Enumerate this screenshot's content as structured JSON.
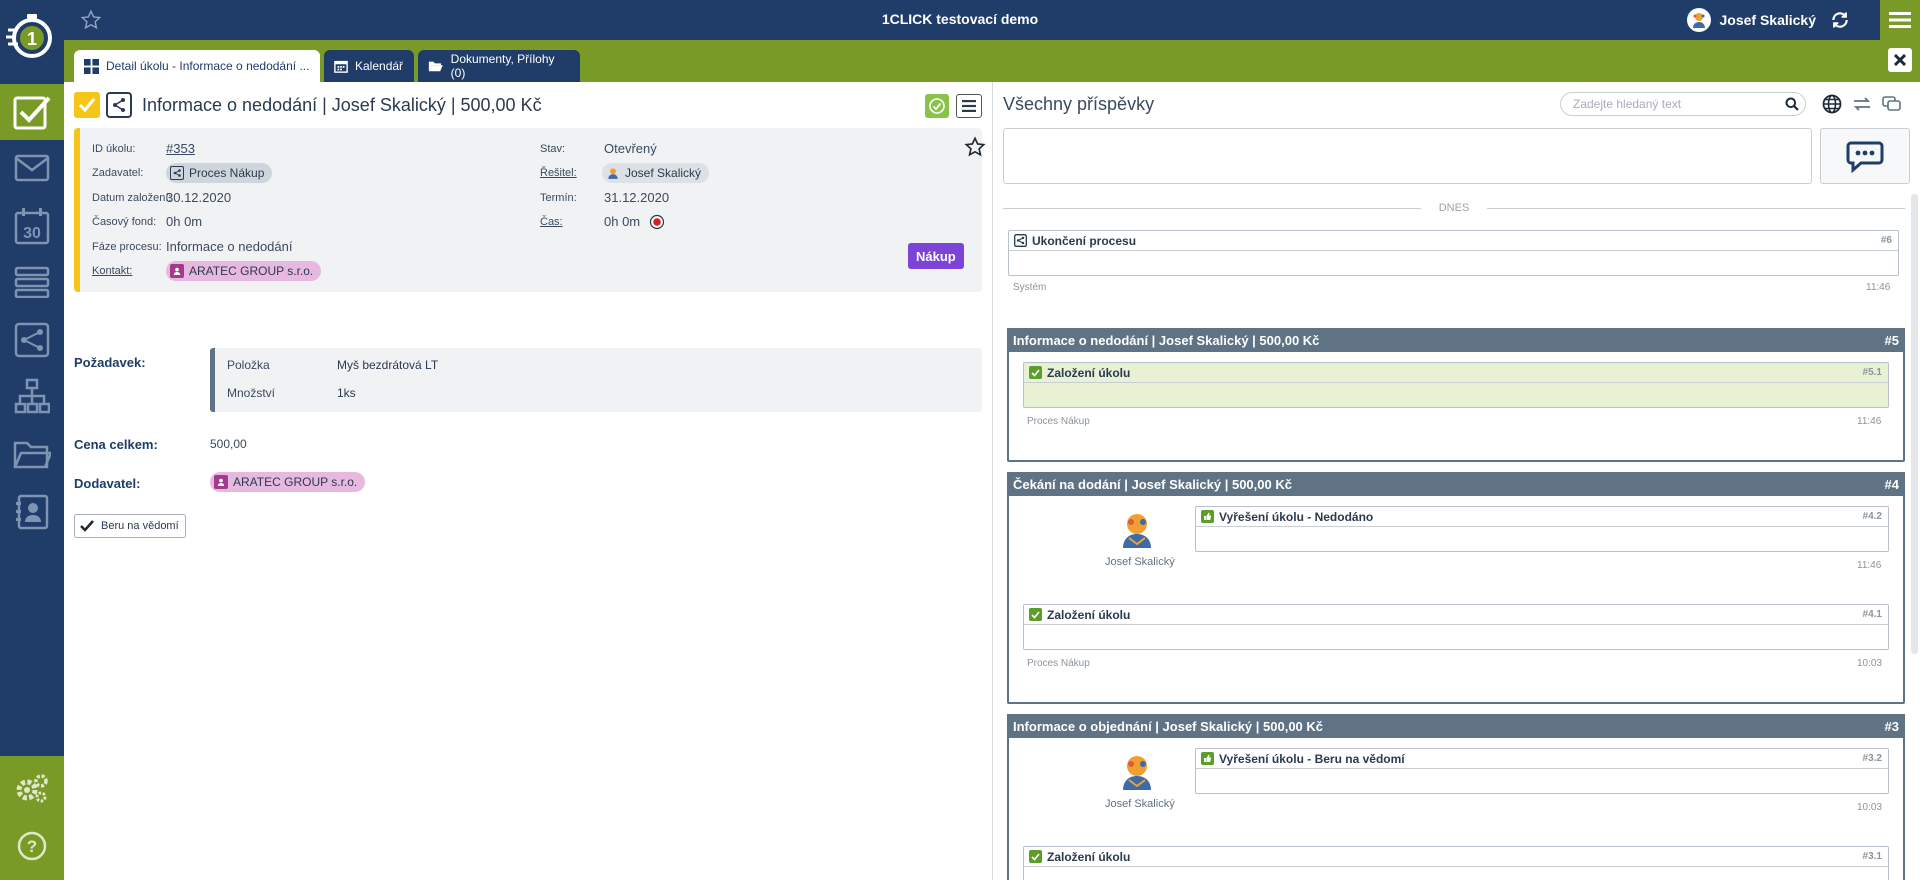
{
  "app": {
    "title": "1CLICK testovací demo",
    "user_name": "Josef Skalický"
  },
  "tabs": [
    {
      "label": "Detail úkolu - Informace o nedodání ...",
      "icon": "dashboard-icon",
      "active": true
    },
    {
      "label": "Kalendář",
      "icon": "calendar-icon",
      "active": false
    },
    {
      "label": "Dokumenty, Přílohy (0)",
      "icon": "folder-open-icon",
      "active": false
    }
  ],
  "sidebar": {
    "items": [
      {
        "name": "tasks",
        "icon": "checkbox-icon",
        "active": true
      },
      {
        "name": "mail",
        "icon": "envelope-icon"
      },
      {
        "name": "calendar",
        "icon": "calendar-30-icon",
        "label": "30"
      },
      {
        "name": "lists",
        "icon": "list-icon"
      },
      {
        "name": "processes",
        "icon": "process-icon"
      },
      {
        "name": "org",
        "icon": "org-chart-icon"
      },
      {
        "name": "documents",
        "icon": "folder-icon"
      },
      {
        "name": "contacts",
        "icon": "contact-card-icon"
      }
    ],
    "bottom": [
      {
        "name": "settings",
        "icon": "gears-icon"
      },
      {
        "name": "help",
        "icon": "help-icon",
        "label": "?"
      }
    ]
  },
  "task": {
    "title": "Informace o nedodání | Josef Skalický | 500,00 Kč",
    "fields": {
      "id_label": "ID úkolu:",
      "id_value": "#353",
      "zadavatel_label": "Zadavatel:",
      "zadavatel_value": "Proces Nákup",
      "datum_label": "Datum založení:",
      "datum_value": "30.12.2020",
      "fond_label": "Časový fond:",
      "fond_value": "0h 0m",
      "faze_label": "Fáze procesu:",
      "faze_value": "Informace o nedodání",
      "kontakt_label": "Kontakt:",
      "kontakt_value": "ARATEC GROUP s.r.o.",
      "stav_label": "Stav:",
      "stav_value": "Otevřený",
      "resitel_label": "Řešitel:",
      "resitel_value": "Josef Skalický",
      "termin_label": "Termín:",
      "termin_value": "31.12.2020",
      "cas_label": "Čas:",
      "cas_value": "0h 0m"
    },
    "badge": "Nákup",
    "badge_color": "#7b43d6",
    "requirement_label": "Požadavek:",
    "requirement_rows": [
      {
        "key": "Položka",
        "value": "Myš bezdrátová LT"
      },
      {
        "key": "Množství",
        "value": "1ks"
      }
    ],
    "total_label": "Cena celkem:",
    "total_value": "500,00",
    "supplier_label": "Dodavatel:",
    "supplier_value": "ARATEC GROUP s.r.o.",
    "ack_button": "Beru na vědomí"
  },
  "posts_panel": {
    "title": "Všechny příspěvky",
    "search_placeholder": "Zadejte hledaný text",
    "day_separator": "DNES",
    "system_post": {
      "title": "Ukončení procesu",
      "num": "#6",
      "author": "Systém",
      "time": "11:46"
    },
    "groups": [
      {
        "title": "Informace o nedodání | Josef Skalický | 500,00 Kč",
        "num": "#5",
        "posts": [
          {
            "title": "Založení úkolu",
            "num": "#5.1",
            "author": "Proces Nákup",
            "time": "11:46"
          }
        ]
      },
      {
        "title": "Čekání na dodání | Josef Skalický | 500,00 Kč",
        "num": "#4",
        "posts": [
          {
            "title": "Vyřešení úkolu - Nedodáno",
            "num": "#4.2",
            "author": "Josef Skalický",
            "time": "11:46"
          },
          {
            "title": "Založení úkolu",
            "num": "#4.1",
            "author": "Proces Nákup",
            "time": "10:03"
          }
        ]
      },
      {
        "title": "Informace o objednání | Josef Skalický | 500,00 Kč",
        "num": "#3",
        "posts": [
          {
            "title": "Vyřešení úkolu - Beru na vědomí",
            "num": "#3.2",
            "author": "Josef Skalický",
            "time": "10:03"
          },
          {
            "title": "Založení úkolu",
            "num": "#3.1"
          }
        ]
      }
    ]
  },
  "colors": {
    "navy": "#1f3d68",
    "green": "#7a9a28",
    "yellow": "#f5c518",
    "slate": "#5f7384",
    "highlight": "#e8f1d4"
  }
}
